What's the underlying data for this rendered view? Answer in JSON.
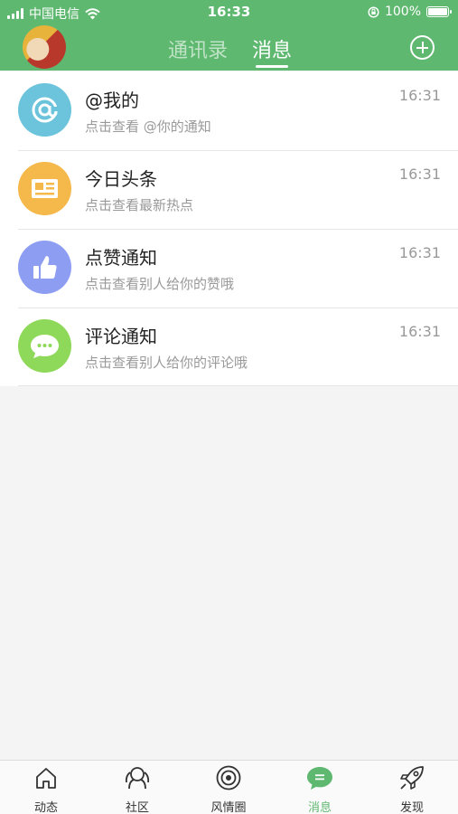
{
  "status_bar": {
    "carrier": "中国电信",
    "time": "16:33",
    "battery": "100%"
  },
  "header": {
    "tabs": [
      "通讯录",
      "消息"
    ],
    "active_tab": "消息"
  },
  "messages": [
    {
      "title": "@我的",
      "subtitle": "点击查看 @你的通知",
      "time": "16:31",
      "icon": "at-icon",
      "color": "#6cc3dc"
    },
    {
      "title": "今日头条",
      "subtitle": "点击查看最新热点",
      "time": "16:31",
      "icon": "newspaper-icon",
      "color": "#f5b84a"
    },
    {
      "title": "点赞通知",
      "subtitle": "点击查看别人给你的赞哦",
      "time": "16:31",
      "icon": "thumbs-up-icon",
      "color": "#8d9ef2"
    },
    {
      "title": "评论通知",
      "subtitle": "点击查看别人给你的评论哦",
      "time": "16:31",
      "icon": "chat-bubble-icon",
      "color": "#8fd95a"
    }
  ],
  "tabbar": [
    {
      "label": "动态",
      "icon": "home-icon"
    },
    {
      "label": "社区",
      "icon": "community-icon"
    },
    {
      "label": "风情圈",
      "icon": "camera-circle-icon"
    },
    {
      "label": "消息",
      "icon": "message-icon",
      "active": true
    },
    {
      "label": "发现",
      "icon": "rocket-icon"
    }
  ],
  "colors": {
    "primary": "#5fb870",
    "background": "#f4f4f4"
  }
}
